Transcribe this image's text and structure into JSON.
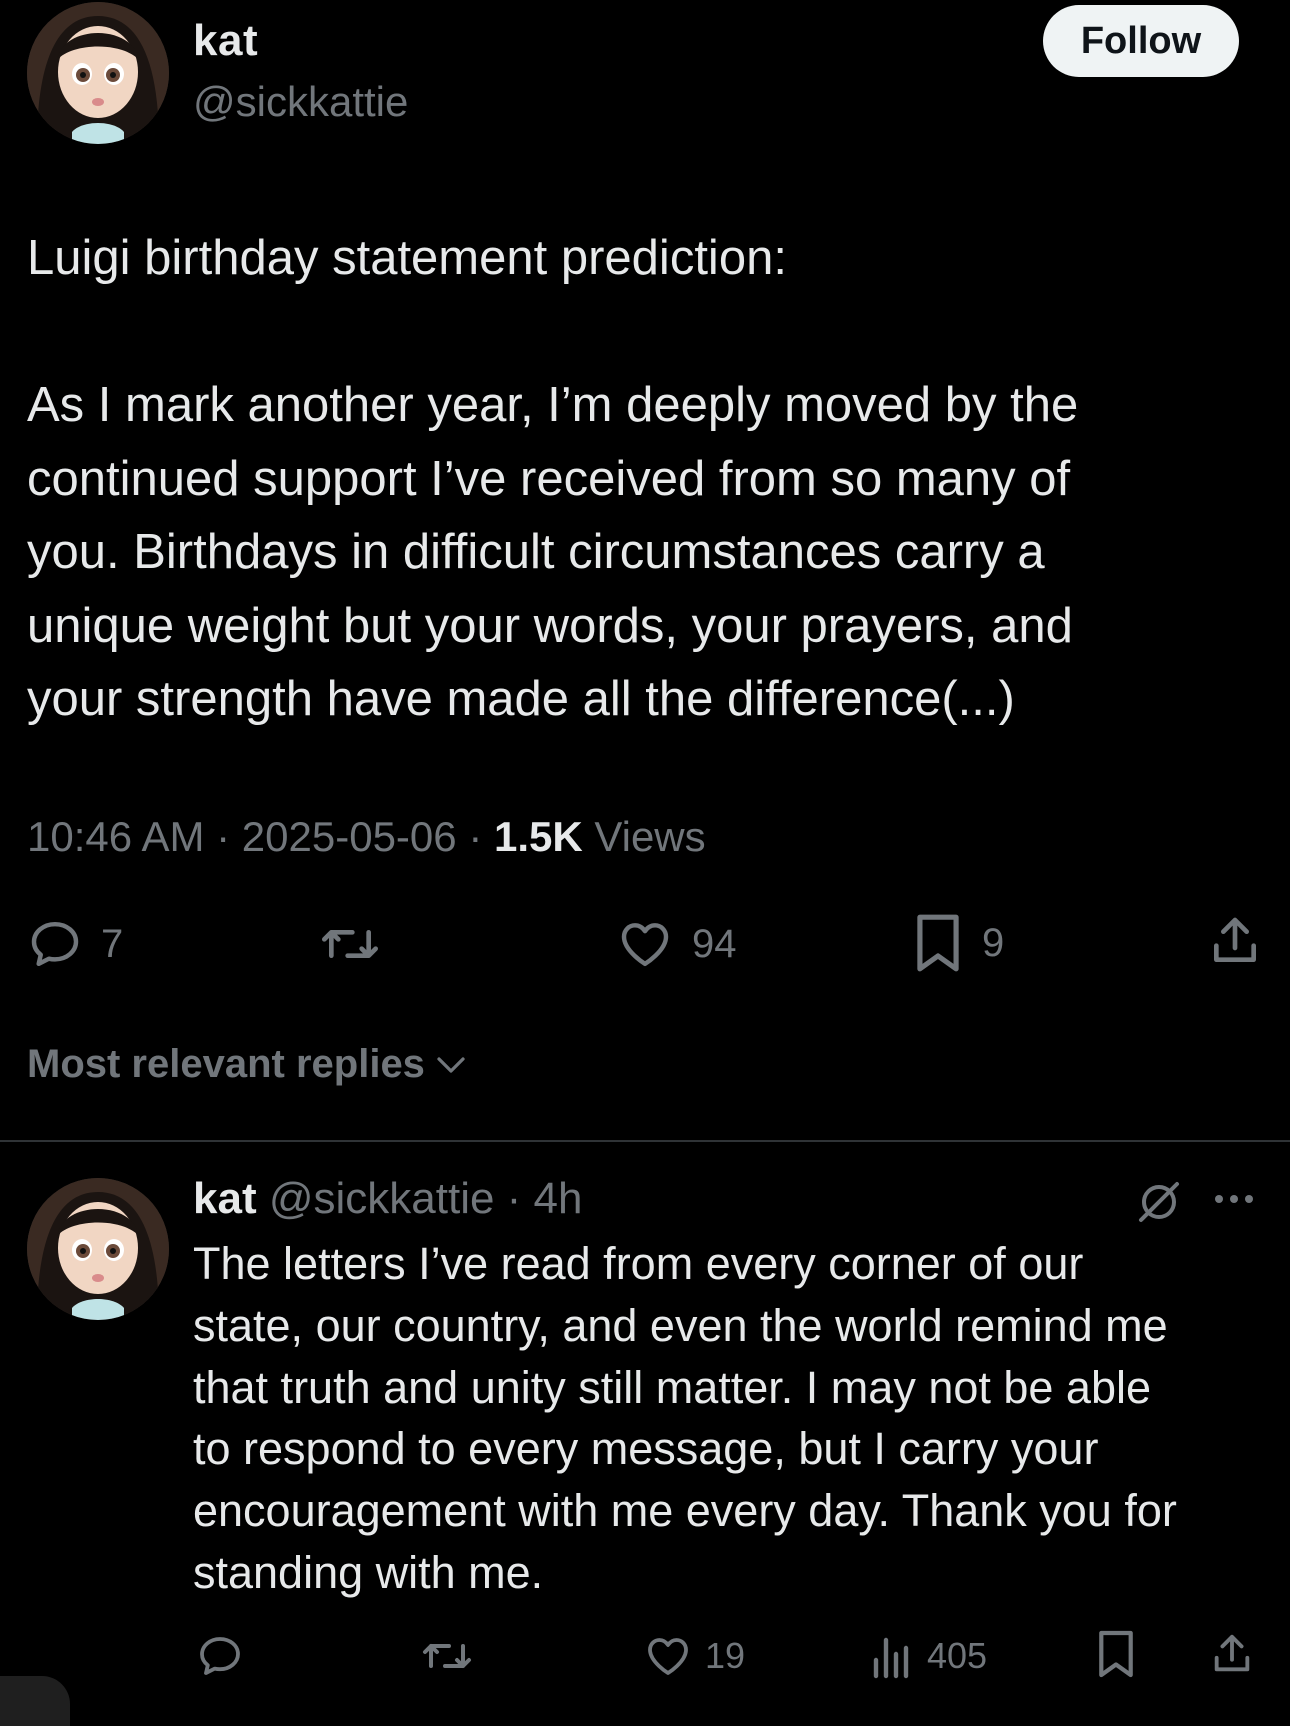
{
  "tweet": {
    "author": {
      "display_name": "kat",
      "handle": "@sickkattie"
    },
    "follow_label": "Follow",
    "text_lines": {
      "l1": "Luigi birthday statement prediction:",
      "l2": "As I mark another year, I’m deeply moved by the",
      "l3": "continued support I’ve received from so many of",
      "l4": "you. Birthdays in difficult circumstances carry a",
      "l5": "unique weight but your words, your prayers, and",
      "l6": "your strength have made all the difference(...)"
    },
    "time": "10:46 AM",
    "date": "2025-05-06",
    "separator": "·",
    "views_count": "1.5K",
    "views_label": "Views",
    "stats": {
      "replies": "7",
      "likes": "94",
      "bookmarks": "9"
    },
    "icons": [
      "reply-icon",
      "retweet-icon",
      "like-icon",
      "bookmark-icon",
      "share-icon"
    ]
  },
  "replies_sort": {
    "label": "Most relevant replies"
  },
  "reply": {
    "display_name": "kat",
    "handle": "@sickkattie",
    "separator": "·",
    "age": "4h",
    "text_lines": {
      "l1": "The letters I’ve read from every corner of our",
      "l2": "state, our country, and even the world remind me",
      "l3": "that truth and unity still matter. I may not be able",
      "l4": "to respond to every message, but I carry your",
      "l5": "encouragement with me every day. Thank you for",
      "l6": "standing with me."
    },
    "stats": {
      "likes": "19",
      "views": "405"
    },
    "icons": [
      "grok-icon",
      "more-icon",
      "reply-icon",
      "retweet-icon",
      "like-icon",
      "views-icon",
      "bookmark-icon",
      "share-icon"
    ]
  },
  "colors": {
    "background": "#000000",
    "text_primary": "#e7e9ea",
    "text_secondary": "#71767b",
    "follow_button_bg": "#eff3f4",
    "divider": "#2f3336"
  }
}
